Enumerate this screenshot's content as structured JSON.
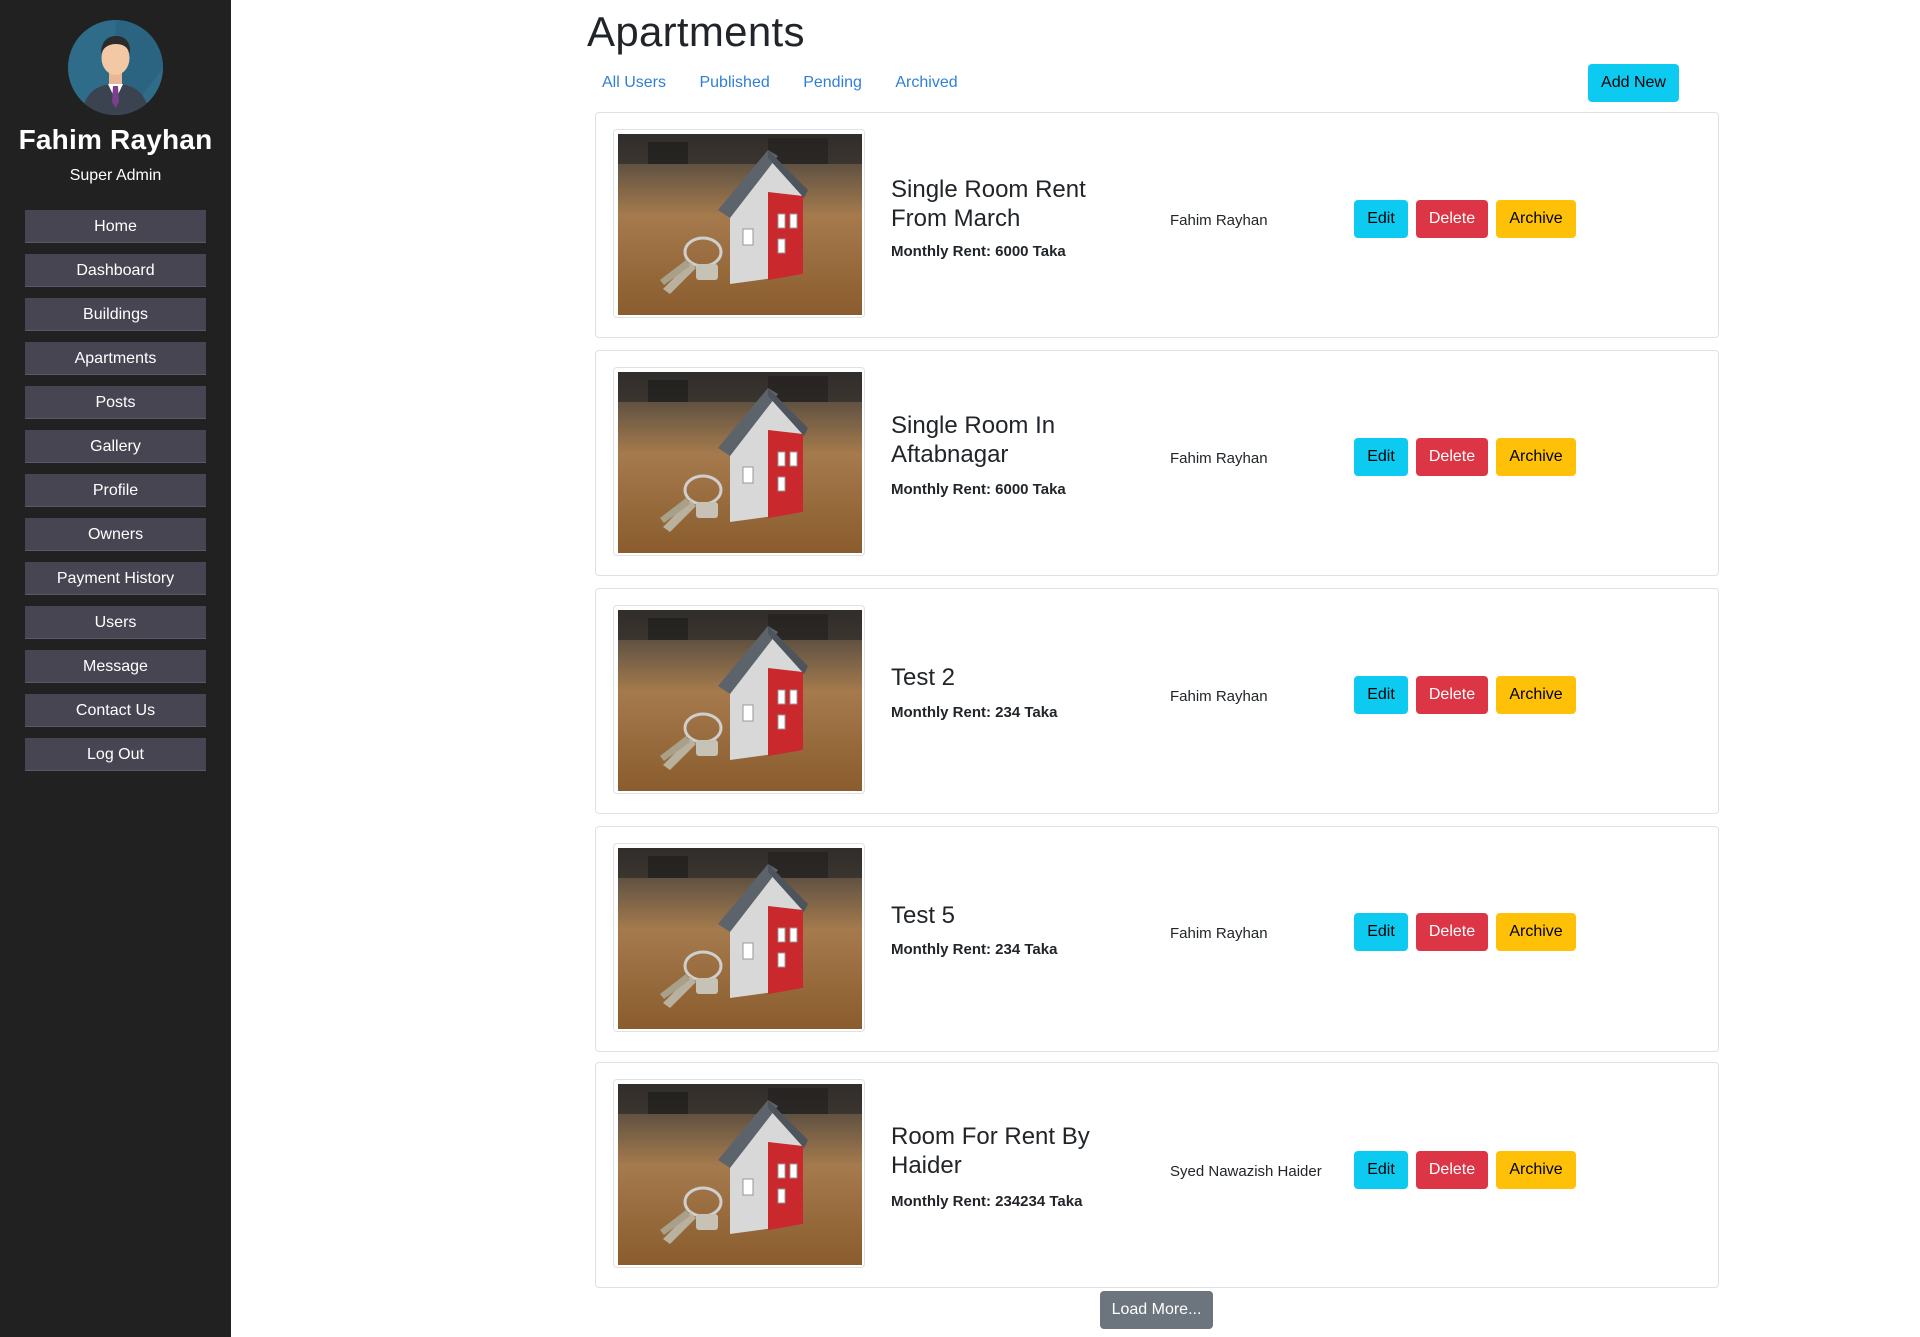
{
  "sidebar": {
    "user_name": "Fahim Rayhan",
    "user_role": "Super Admin",
    "items": [
      {
        "label": "Home"
      },
      {
        "label": "Dashboard"
      },
      {
        "label": "Buildings"
      },
      {
        "label": "Apartments"
      },
      {
        "label": "Posts"
      },
      {
        "label": "Gallery"
      },
      {
        "label": "Profile"
      },
      {
        "label": "Owners"
      },
      {
        "label": "Payment History"
      },
      {
        "label": "Users"
      },
      {
        "label": "Message"
      },
      {
        "label": "Contact Us"
      },
      {
        "label": "Log Out"
      }
    ]
  },
  "main": {
    "title": "Apartments",
    "tabs": [
      {
        "label": "All Users"
      },
      {
        "label": "Published"
      },
      {
        "label": "Pending"
      },
      {
        "label": "Archived"
      }
    ],
    "add_new_label": "Add New",
    "listings": [
      {
        "title": "Single Room Rent From March",
        "rent": "Monthly Rent: 6000 Taka",
        "owner": "Fahim Rayhan"
      },
      {
        "title": "Single Room In Aftabnagar",
        "rent": "Monthly Rent: 6000 Taka",
        "owner": "Fahim Rayhan"
      },
      {
        "title": "Test 2",
        "rent": "Monthly Rent: 234 Taka",
        "owner": "Fahim Rayhan"
      },
      {
        "title": "Test 5",
        "rent": "Monthly Rent: 234 Taka",
        "owner": "Fahim Rayhan"
      },
      {
        "title": "Room For Rent By Haider",
        "rent": "Monthly Rent: 234234 Taka",
        "owner": "Syed Nawazish Haider"
      }
    ],
    "button_labels": {
      "edit": "Edit",
      "delete": "Delete",
      "archive": "Archive"
    },
    "load_more_label": "Load More..."
  },
  "colors": {
    "sidebar_bg": "#212121",
    "nav_item_bg": "#474552",
    "info": "#0dcaf0",
    "danger": "#dc3545",
    "warning": "#ffc107",
    "secondary": "#6c757d",
    "link": "#2f7fd6"
  },
  "icons": {
    "avatar": "user-avatar-icon",
    "thumbnail": "house-with-keys-image"
  }
}
